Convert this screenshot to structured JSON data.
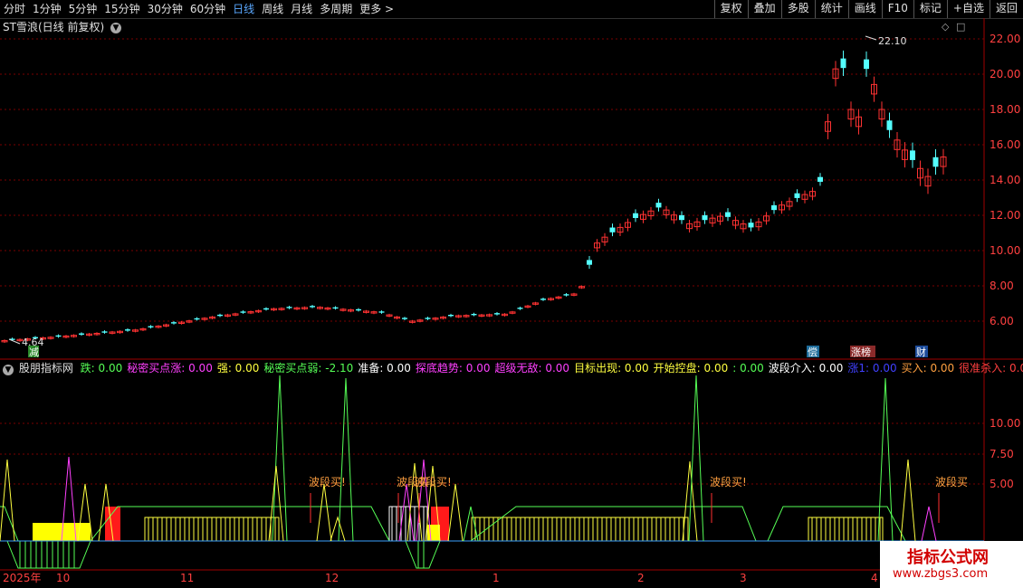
{
  "toolbar": {
    "periods": [
      "分时",
      "1分钟",
      "5分钟",
      "15分钟",
      "30分钟",
      "60分钟",
      "日线",
      "周线",
      "月线",
      "多周期",
      "更多 >"
    ],
    "active_period": "日线",
    "tools": [
      "复权",
      "叠加",
      "多股",
      "统计",
      "画线",
      "F10",
      "标记",
      "+自选",
      "返回"
    ]
  },
  "main": {
    "stock_title": "ST雪浪(日线 前复权)",
    "high_label": "22.10",
    "low_label": "4.64",
    "y_ticks": [
      "22.00",
      "20.00",
      "18.00",
      "16.00",
      "14.00",
      "12.00",
      "10.00",
      "8.00",
      "6.00"
    ],
    "tags": {
      "jian": "减",
      "chang": "偿",
      "zhangbang": "涨榜",
      "cai": "财"
    },
    "colors": {
      "up": "#ff3232",
      "down": "#54ffff",
      "grid": "#7a0000"
    }
  },
  "indicator": {
    "name": "股朋指标网",
    "fields": [
      {
        "label": "跌:",
        "value": "0.00",
        "color": "#56ff56"
      },
      {
        "label": "秘密买点涨:",
        "value": "0.00",
        "color": "#ff40ff"
      },
      {
        "label": "强:",
        "value": "0.00",
        "color": "#ffff40"
      },
      {
        "label": "秘密买点弱:",
        "value": "-2.10",
        "color": "#56ff56"
      },
      {
        "label": "准备:",
        "value": "0.00",
        "color": "#ffffff"
      },
      {
        "label": "探底趋势:",
        "value": "0.00",
        "color": "#ff40ff"
      },
      {
        "label": "超级无敌:",
        "value": "0.00",
        "color": "#ff40ff"
      },
      {
        "label": "目标出现:",
        "value": "0.00",
        "color": "#ffff40"
      },
      {
        "label": "开始控盘:",
        "value": "0.00",
        "color": "#ffff40"
      },
      {
        "label": ":",
        "value": "0.00",
        "color": "#56ff56"
      },
      {
        "label": "波段介入:",
        "value": "0.00",
        "color": "#ffffff"
      },
      {
        "label": "涨1:",
        "value": "0.00",
        "color": "#4040ff"
      },
      {
        "label": "买入:",
        "value": "0.00",
        "color": "#ffa040"
      },
      {
        "label": "很准杀入:",
        "value": "0.00",
        "color": "#ff4040"
      }
    ],
    "y_ticks": [
      "10.00",
      "7.50",
      "5.00"
    ],
    "signals": [
      "波段买!",
      "波段买!",
      "波段买!",
      "波段买!",
      "波段买"
    ],
    "x_labels": [
      "2025年",
      "10",
      "11",
      "12",
      "1",
      "2",
      "3",
      "4"
    ]
  },
  "watermark": {
    "title": "指标公式网",
    "url": "www.zbgs3.com"
  }
}
